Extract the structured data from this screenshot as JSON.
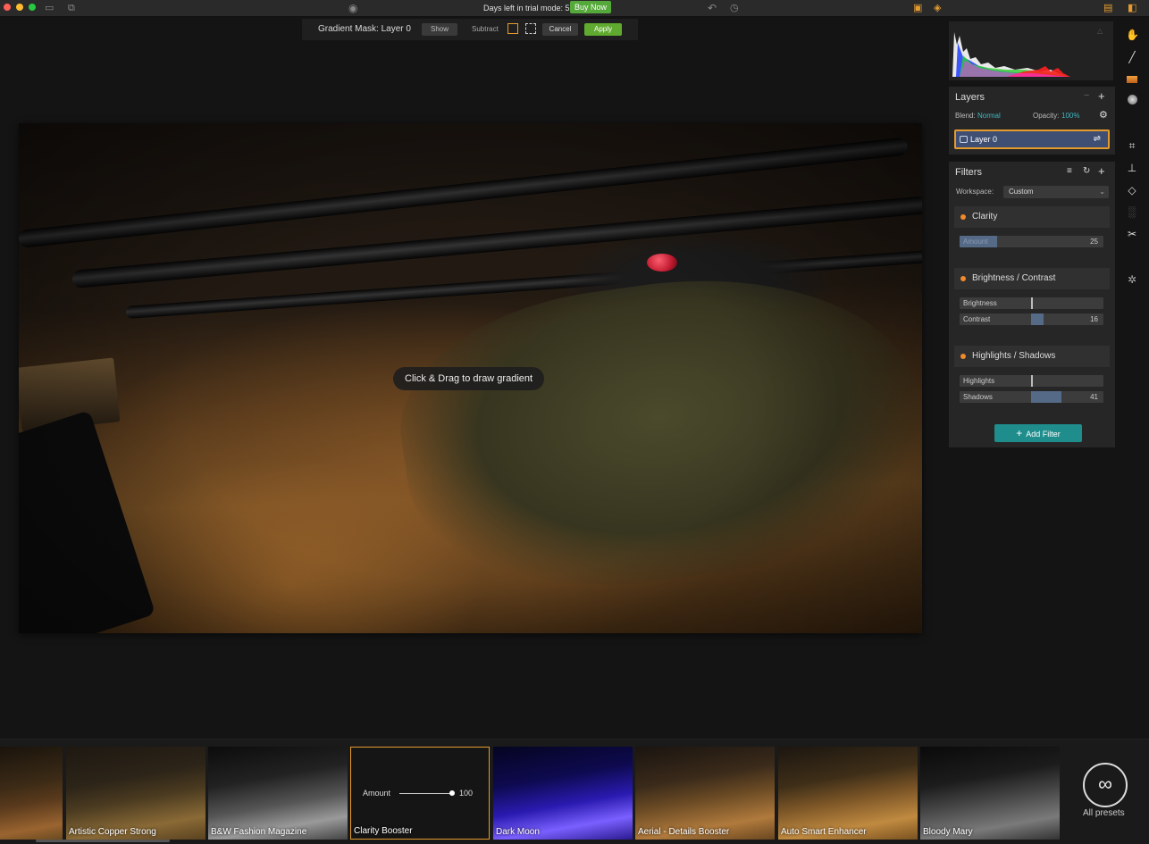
{
  "titlebar": {
    "trial_text": "Days left in trial mode: 5",
    "buy_now": "Buy Now",
    "icons": [
      "close-icon",
      "minimize-icon",
      "zoom-icon",
      "open-folder-icon",
      "batch-icon",
      "share-icon",
      "preview-eye-icon",
      "compare-icon",
      "undo-icon",
      "history-icon",
      "image-icon",
      "layers-icon",
      "layout-icon",
      "sidebar-icon"
    ]
  },
  "mask_toolbar": {
    "title": "Gradient Mask: Layer 0",
    "show": "Show",
    "subtract": "Subtract",
    "cancel": "Cancel",
    "apply": "Apply"
  },
  "canvas": {
    "hint": "Click & Drag to draw gradient"
  },
  "layers": {
    "title": "Layers",
    "blend_label": "Blend:",
    "blend_value": "Normal",
    "opacity_label": "Opacity:",
    "opacity_value": "100%",
    "layer_name": "Layer 0"
  },
  "filters": {
    "title": "Filters",
    "workspace_label": "Workspace:",
    "workspace_value": "Custom",
    "items": [
      {
        "name": "Clarity",
        "sliders": [
          {
            "label": "Amount",
            "value": "25",
            "fill": 0.25
          }
        ]
      },
      {
        "name": "Brightness / Contrast",
        "sliders": [
          {
            "label": "Brightness",
            "value": "",
            "fill": 0
          },
          {
            "label": "Contrast",
            "value": "16",
            "fill": 0.16
          }
        ]
      },
      {
        "name": "Highlights / Shadows",
        "sliders": [
          {
            "label": "Highlights",
            "value": "",
            "fill": 0
          },
          {
            "label": "Shadows",
            "value": "41",
            "fill": 0.41
          }
        ]
      }
    ],
    "add_filter": "Add Filter"
  },
  "presets": {
    "items": [
      {
        "name": ""
      },
      {
        "name": "Artistic Copper Strong"
      },
      {
        "name": "B&W Fashion Magazine"
      },
      {
        "name": "Clarity Booster"
      },
      {
        "name": "Dark Moon"
      },
      {
        "name": "Aerial - Details Booster"
      },
      {
        "name": "Auto Smart Enhancer"
      },
      {
        "name": "Bloody Mary"
      }
    ],
    "selected_amount_label": "Amount",
    "selected_amount_value": "100",
    "all_presets": "All presets"
  },
  "colors": {
    "accent_orange": "#e49b2e",
    "apply_green": "#5faa2f",
    "add_filter_teal": "#1e8d8c",
    "layer_blue": "#3e4f73"
  }
}
